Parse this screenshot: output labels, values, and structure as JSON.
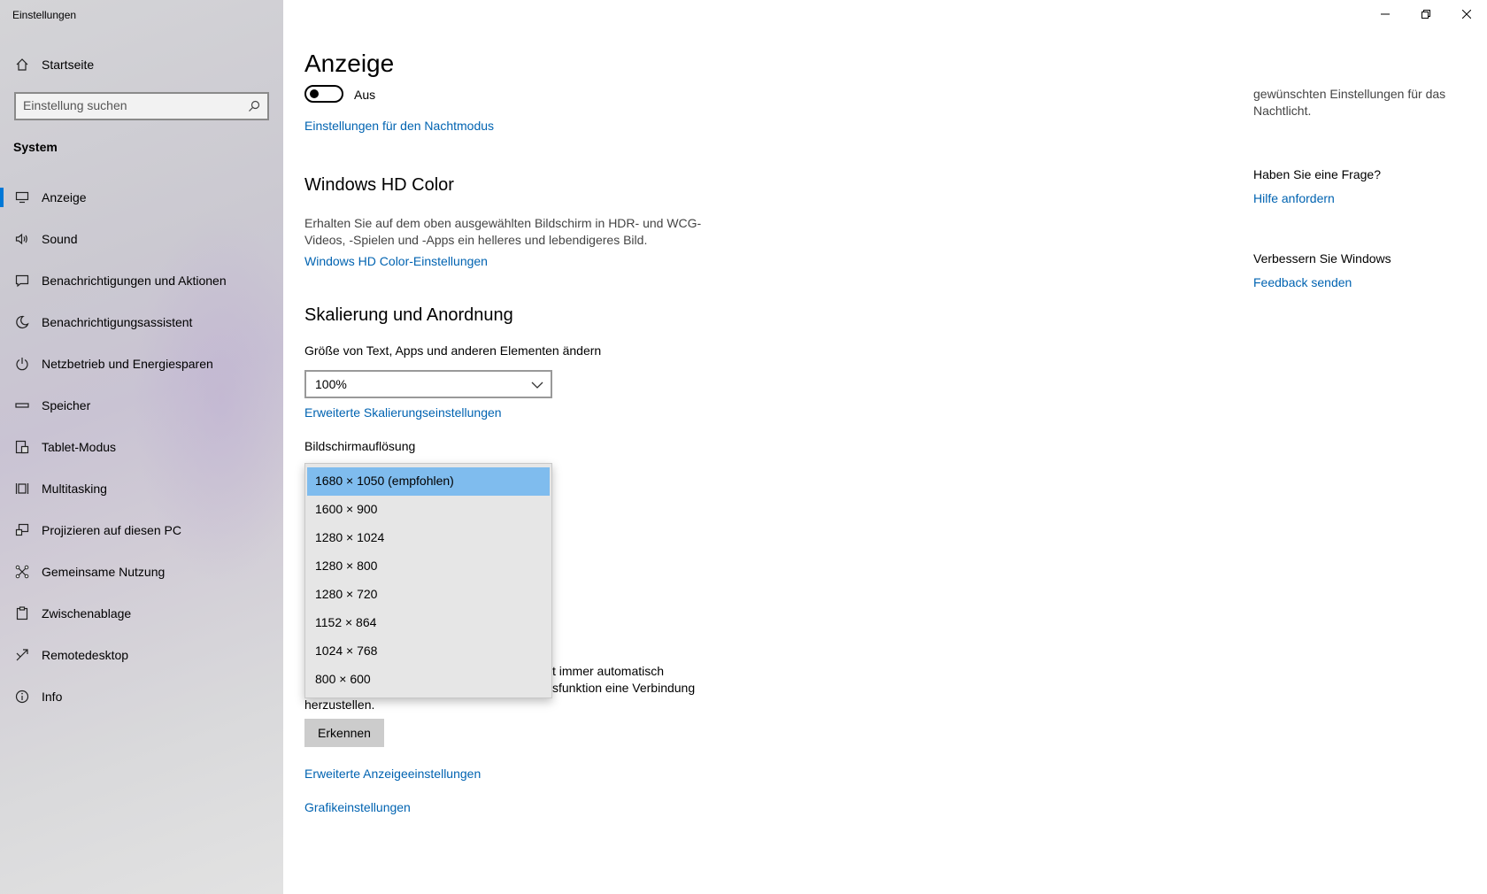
{
  "window": {
    "title": "Einstellungen",
    "controls": [
      "minimize-icon",
      "restore-icon",
      "close-icon"
    ]
  },
  "sidebar": {
    "home_label": "Startseite",
    "search_placeholder": "Einstellung suchen",
    "section": "System",
    "items": [
      {
        "label": "Anzeige",
        "icon": "monitor-icon",
        "active": true
      },
      {
        "label": "Sound",
        "icon": "speaker-icon"
      },
      {
        "label": "Benachrichtigungen und Aktionen",
        "icon": "notification-icon"
      },
      {
        "label": "Benachrichtigungsassistent",
        "icon": "moon-icon"
      },
      {
        "label": "Netzbetrieb und Energiesparen",
        "icon": "power-icon"
      },
      {
        "label": "Speicher",
        "icon": "storage-icon"
      },
      {
        "label": "Tablet-Modus",
        "icon": "tablet-icon"
      },
      {
        "label": "Multitasking",
        "icon": "multitasking-icon"
      },
      {
        "label": "Projizieren auf diesen PC",
        "icon": "project-icon"
      },
      {
        "label": "Gemeinsame Nutzung",
        "icon": "share-icon"
      },
      {
        "label": "Zwischenablage",
        "icon": "clipboard-icon"
      },
      {
        "label": "Remotedesktop",
        "icon": "remote-icon"
      },
      {
        "label": "Info",
        "icon": "info-icon"
      }
    ]
  },
  "main": {
    "title": "Anzeige",
    "night_toggle_label": "Aus",
    "night_toggle_on": false,
    "night_link": "Einstellungen für den Nachtmodus",
    "hd_title": "Windows HD Color",
    "hd_desc": "Erhalten Sie auf dem oben ausgewählten Bildschirm in HDR- und WCG-Videos, -Spielen und -Apps ein helleres und lebendigeres Bild.",
    "hd_link": "Windows HD Color-Einstellungen",
    "scale_title": "Skalierung und Anordnung",
    "scale_label": "Größe von Text, Apps und anderen Elementen ändern",
    "scale_value": "100%",
    "scale_link": "Erweiterte Skalierungseinstellungen",
    "resolution_label": "Bildschirmauflösung",
    "resolution_options": [
      "1680 × 1050 (empfohlen)",
      "1600 × 900",
      "1280 × 1024",
      "1280 × 800",
      "1280 × 720",
      "1152 × 864",
      "1024 × 768",
      "800 × 600"
    ],
    "resolution_selected_index": 0,
    "behind_line1": "t immer automatisch",
    "behind_line2": "sfunktion eine Verbindung",
    "behind_line3": "herzustellen.",
    "detect_button": "Erkennen",
    "advanced_display_link": "Erweiterte Anzeigeeinstellungen",
    "graphics_link": "Grafikeinstellungen"
  },
  "right_panel": {
    "night_text": "gewünschten Einstellungen für das Nachtlicht.",
    "question_head": "Haben Sie eine Frage?",
    "help_link": "Hilfe anfordern",
    "improve_head": "Verbessern Sie Windows",
    "feedback_link": "Feedback senden"
  },
  "colors": {
    "accent": "#0078d7",
    "link": "#0063b1",
    "selected_option": "#7fbcee"
  }
}
